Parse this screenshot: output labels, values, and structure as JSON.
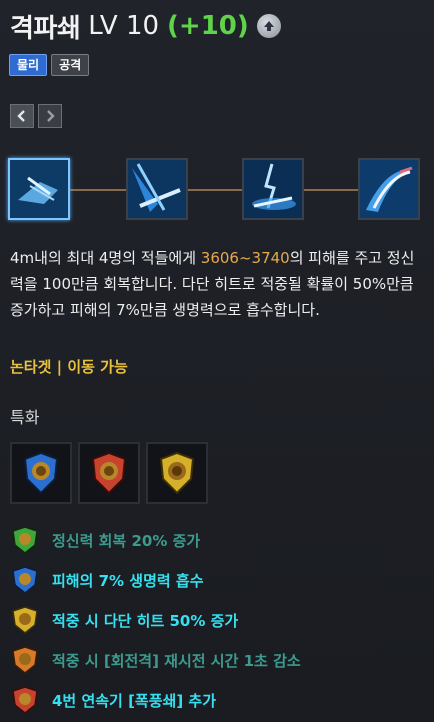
{
  "skill": {
    "name": "격파쇄",
    "level": "LV 10",
    "bonus": "(+10)",
    "tags": [
      "물리",
      "공격"
    ]
  },
  "description": {
    "part1": "4m내의 최대 4명의 적들에게 ",
    "damage": "3606~3740",
    "part2": "의 피해를 주고 정신력을 100만큼 회복합니다. 다단 히트로 적중될 확률이 50%만큼 증가하고 피해의 7%만큼 생명력으로 흡수합니다."
  },
  "info": "논타겟 | 이동 가능",
  "specialization_label": "특화",
  "gems": [
    {
      "icon": "blue-gem-icon",
      "color": "#2b6fd1"
    },
    {
      "icon": "red-gem-icon",
      "color": "#c8432e"
    },
    {
      "icon": "yellow-gem-icon",
      "color": "#d6b02a"
    }
  ],
  "effects": [
    {
      "text": "정신력 회복 20% 증가",
      "color": "#3c9b8e",
      "icon_color": "#3ea63a"
    },
    {
      "text": "피해의 7% 생명력 흡수",
      "color": "#36e0f0",
      "icon_color": "#2b6fd1"
    },
    {
      "text": "적중 시 다단 히트 50% 증가",
      "color": "#36e0f0",
      "icon_color": "#d6b02a"
    },
    {
      "text": "적중 시 [회전격] 재시전 시간 1초 감소",
      "color": "#3c9b8e",
      "icon_color": "#d87a2a"
    },
    {
      "text": "4번 연속기 [폭풍쇄] 추가",
      "color": "#36e0f0",
      "icon_color": "#c8432e"
    }
  ],
  "colors": {
    "bonus": "#5fd34a",
    "damage": "#e8a94c",
    "info": "#e8c23c",
    "effect_active": "#36e0f0",
    "effect_inactive": "#3c9b8e"
  }
}
